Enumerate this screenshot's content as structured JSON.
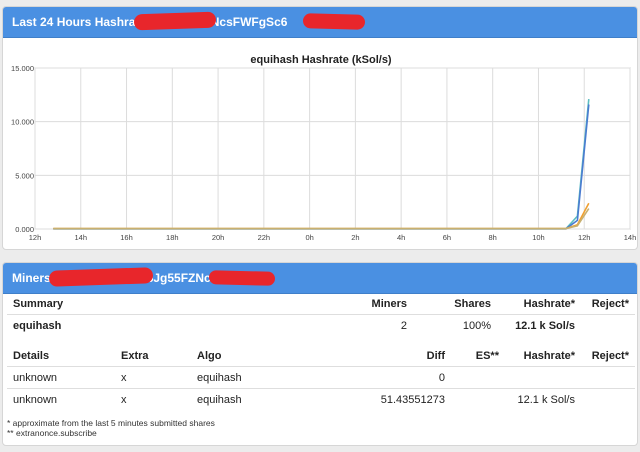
{
  "hashrate_panel": {
    "title_prefix": "Last 24 Hours Hashrate:",
    "title_address_visible": "t5Jg55FZNcsFWFgSc6"
  },
  "chart_data": {
    "type": "line",
    "title": "equihash Hashrate (kSol/s)",
    "y_tick_labels": [
      "0.000",
      "5.000",
      "10.000",
      "15.000"
    ],
    "y_ticks": [
      0,
      5,
      10,
      15
    ],
    "ylim": [
      0,
      15
    ],
    "x_tick_labels": [
      "12h",
      "14h",
      "16h",
      "18h",
      "20h",
      "22h",
      "0h",
      "2h",
      "4h",
      "6h",
      "8h",
      "10h",
      "12h",
      "14h"
    ],
    "xlim": [
      0,
      26
    ],
    "grid": true,
    "series": [
      {
        "color": "#5bbec2",
        "x": [
          0.8,
          23.2,
          23.7,
          24.2
        ],
        "y": [
          0.02,
          0.02,
          1.2,
          12.1
        ]
      },
      {
        "color": "#4a7bd0",
        "x": [
          0.8,
          23.2,
          23.7,
          24.2
        ],
        "y": [
          0.02,
          0.02,
          0.8,
          11.6
        ]
      },
      {
        "color": "#f0a030",
        "x": [
          0.8,
          23.2,
          23.7,
          24.2
        ],
        "y": [
          0.04,
          0.04,
          0.4,
          2.4
        ]
      },
      {
        "color": "#c8b070",
        "x": [
          0.8,
          23.2,
          23.7,
          24.2
        ],
        "y": [
          0.04,
          0.04,
          0.3,
          1.9
        ]
      }
    ]
  },
  "miners_panel": {
    "title_prefix": "Miners:",
    "title_address_visible": "5Jg55FZNcsFWg"
  },
  "summary_table": {
    "headers": [
      "Summary",
      "Miners",
      "Shares",
      "Hashrate*",
      "Reject*"
    ],
    "row": {
      "algo": "equihash",
      "miners": "2",
      "shares": "100%",
      "hashrate": "12.1 k Sol/s",
      "reject": ""
    }
  },
  "details_table": {
    "headers": [
      "Details",
      "Extra",
      "Algo",
      "Diff",
      "ES**",
      "Hashrate*",
      "Reject*"
    ],
    "rows": [
      {
        "details": "unknown",
        "extra": "x",
        "algo": "equihash",
        "diff": "0",
        "es": "",
        "hashrate": "",
        "reject": ""
      },
      {
        "details": "unknown",
        "extra": "x",
        "algo": "equihash",
        "diff": "51.43551273",
        "es": "",
        "hashrate": "12.1 k Sol/s",
        "reject": ""
      }
    ]
  },
  "footnotes": {
    "note1": "* approximate from the last 5 minutes submitted shares",
    "note2": "** extranonce.subscribe"
  }
}
